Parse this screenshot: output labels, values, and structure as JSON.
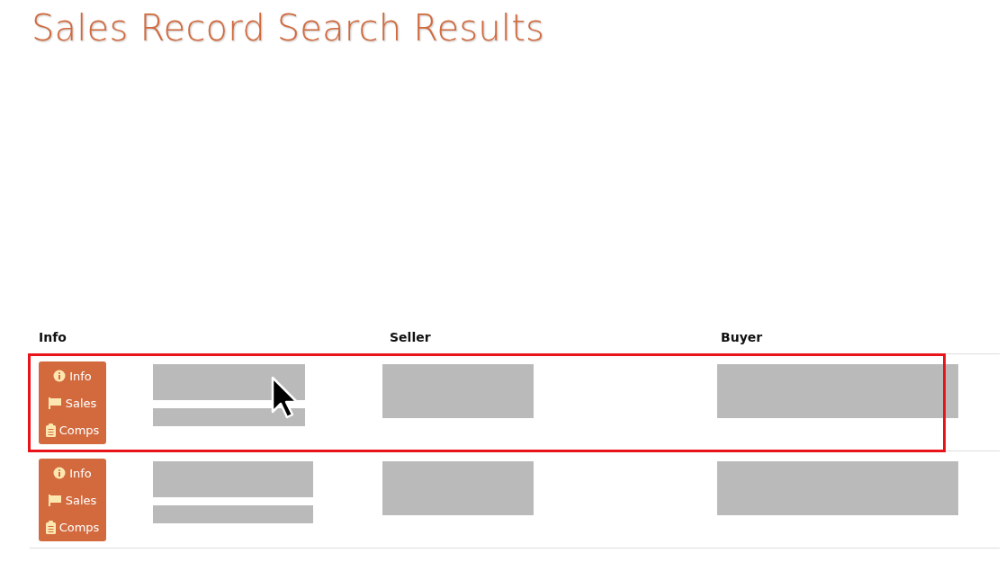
{
  "page": {
    "title": "Sales Record Search Results"
  },
  "table": {
    "columns": [
      "Info",
      "Seller",
      "Buyer"
    ],
    "rows": [
      {
        "highlighted": true,
        "actions": [
          {
            "kind": "info",
            "label": "Info"
          },
          {
            "kind": "sales",
            "label": "Sales"
          },
          {
            "kind": "comps",
            "label": "Comps"
          }
        ]
      },
      {
        "highlighted": false,
        "actions": [
          {
            "kind": "info",
            "label": "Info"
          },
          {
            "kind": "sales",
            "label": "Sales"
          },
          {
            "kind": "comps",
            "label": "Comps"
          }
        ]
      }
    ]
  }
}
